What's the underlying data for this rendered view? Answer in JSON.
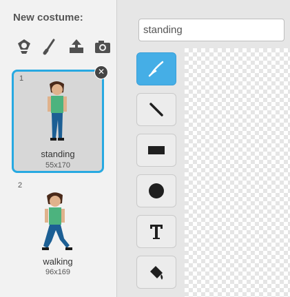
{
  "costume_panel": {
    "new_costume_label": "New costume:",
    "tools": [
      "paint-new-costume-icon",
      "brush-icon",
      "upload-costume-icon",
      "camera-icon"
    ],
    "costumes": [
      {
        "number": "1",
        "name": "standing",
        "size": "55x170",
        "selected": true
      },
      {
        "number": "2",
        "name": "walking",
        "size": "96x169",
        "selected": false
      }
    ]
  },
  "editor": {
    "costume_name_value": "standing",
    "tools": [
      {
        "name": "brush-tool-icon",
        "active": true
      },
      {
        "name": "line-tool-icon",
        "active": false
      },
      {
        "name": "rectangle-tool-icon",
        "active": false
      },
      {
        "name": "ellipse-tool-icon",
        "active": false
      },
      {
        "name": "text-tool-icon",
        "active": false
      },
      {
        "name": "fill-tool-icon",
        "active": false
      }
    ]
  },
  "colors": {
    "selection_border": "#27a9e1",
    "active_tool": "#45aee6"
  }
}
